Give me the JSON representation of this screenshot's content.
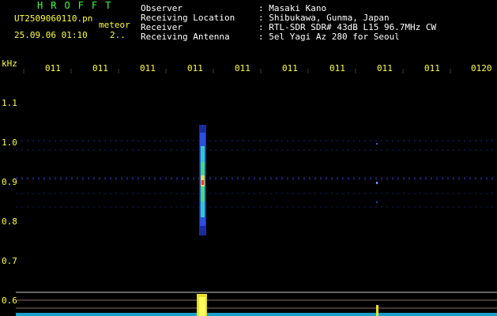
{
  "header": {
    "app_title": "HROFFT",
    "file_name": "UT2509060110.pn",
    "file_suffix": "meteor",
    "timestamp": "25.09.06 01:10",
    "timestamp_extra": "2..",
    "observer_label": "Observer",
    "observer_value": ": Masaki Kano",
    "location_label": "Receiving Location",
    "location_value": ": Shibukawa, Gunma, Japan",
    "receiver_label": "Receiver",
    "receiver_value": ": RTL-SDR SDR# 43dB L15 96.7MHz CW",
    "antenna_label": "Receiving Antenna",
    "antenna_value": ": 5el Yagi Az 280 for Seoul"
  },
  "axis": {
    "unit": "kHz",
    "time_ticks": [
      "011",
      "011",
      "011",
      "011",
      "011",
      "011",
      "011",
      "011",
      "011",
      "0120"
    ],
    "freq_ticks": [
      "1.1",
      "1.0",
      "0.9",
      "0.8",
      "0.7",
      "0.6"
    ]
  },
  "colors": {
    "title": "#3cff3c",
    "label": "#ffff3c",
    "info": "#ffffff",
    "signal_line": "#2a3cc8",
    "baseline": "#20c8ff"
  }
}
